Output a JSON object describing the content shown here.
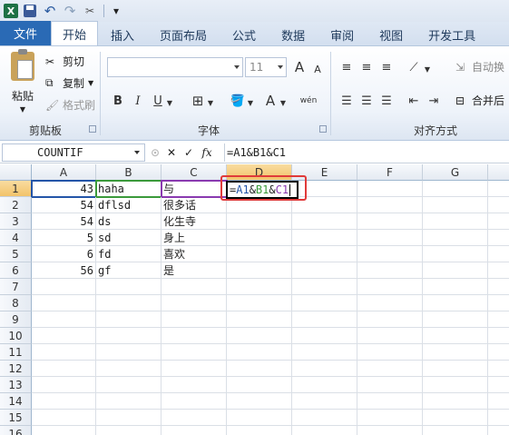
{
  "qat": {
    "app_icon": "X",
    "undo": "↶",
    "redo": "↷",
    "customize": "▾"
  },
  "tabs": {
    "file": "文件",
    "items": [
      "开始",
      "插入",
      "页面布局",
      "公式",
      "数据",
      "审阅",
      "视图",
      "开发工具"
    ],
    "active_index": 0
  },
  "ribbon": {
    "clipboard": {
      "paste": "粘贴",
      "cut": "剪切",
      "copy": "复制",
      "format_painter": "格式刷",
      "label": "剪贴板"
    },
    "font": {
      "size": "11",
      "bold": "B",
      "italic": "I",
      "underline": "U",
      "grow": "A",
      "shrink": "A",
      "font_color": "A",
      "wen": "wén",
      "label": "字体"
    },
    "alignment": {
      "wrap": "自动换",
      "merge": "合并后",
      "label": "对齐方式"
    }
  },
  "formula_bar": {
    "name_box": "COUNTIF",
    "cancel": "✕",
    "enter": "✓",
    "fx": "fx",
    "formula": "=A1&B1&C1"
  },
  "grid": {
    "columns": [
      "A",
      "B",
      "C",
      "D",
      "E",
      "F",
      "G"
    ],
    "rows": [
      "1",
      "2",
      "3",
      "4",
      "5",
      "6",
      "7",
      "8",
      "9",
      "10",
      "11",
      "12",
      "13",
      "14",
      "15",
      "16"
    ],
    "data": [
      [
        "43",
        "haha",
        "与"
      ],
      [
        "54",
        "dflsd",
        "很多话"
      ],
      [
        "54",
        "ds",
        "化生寺"
      ],
      [
        "5",
        "sd",
        "身上"
      ],
      [
        "6",
        "fd",
        "喜欢"
      ],
      [
        "56",
        "gf",
        "是"
      ]
    ],
    "editing_cell": {
      "eq": "=",
      "ref_a": "A1",
      "amp1": "&",
      "ref_b": "B1",
      "amp2": "&",
      "ref_c": "C1"
    },
    "ref_colors": {
      "a": "#2455a8",
      "b": "#3b9a3b",
      "c": "#8a3ab0"
    }
  }
}
